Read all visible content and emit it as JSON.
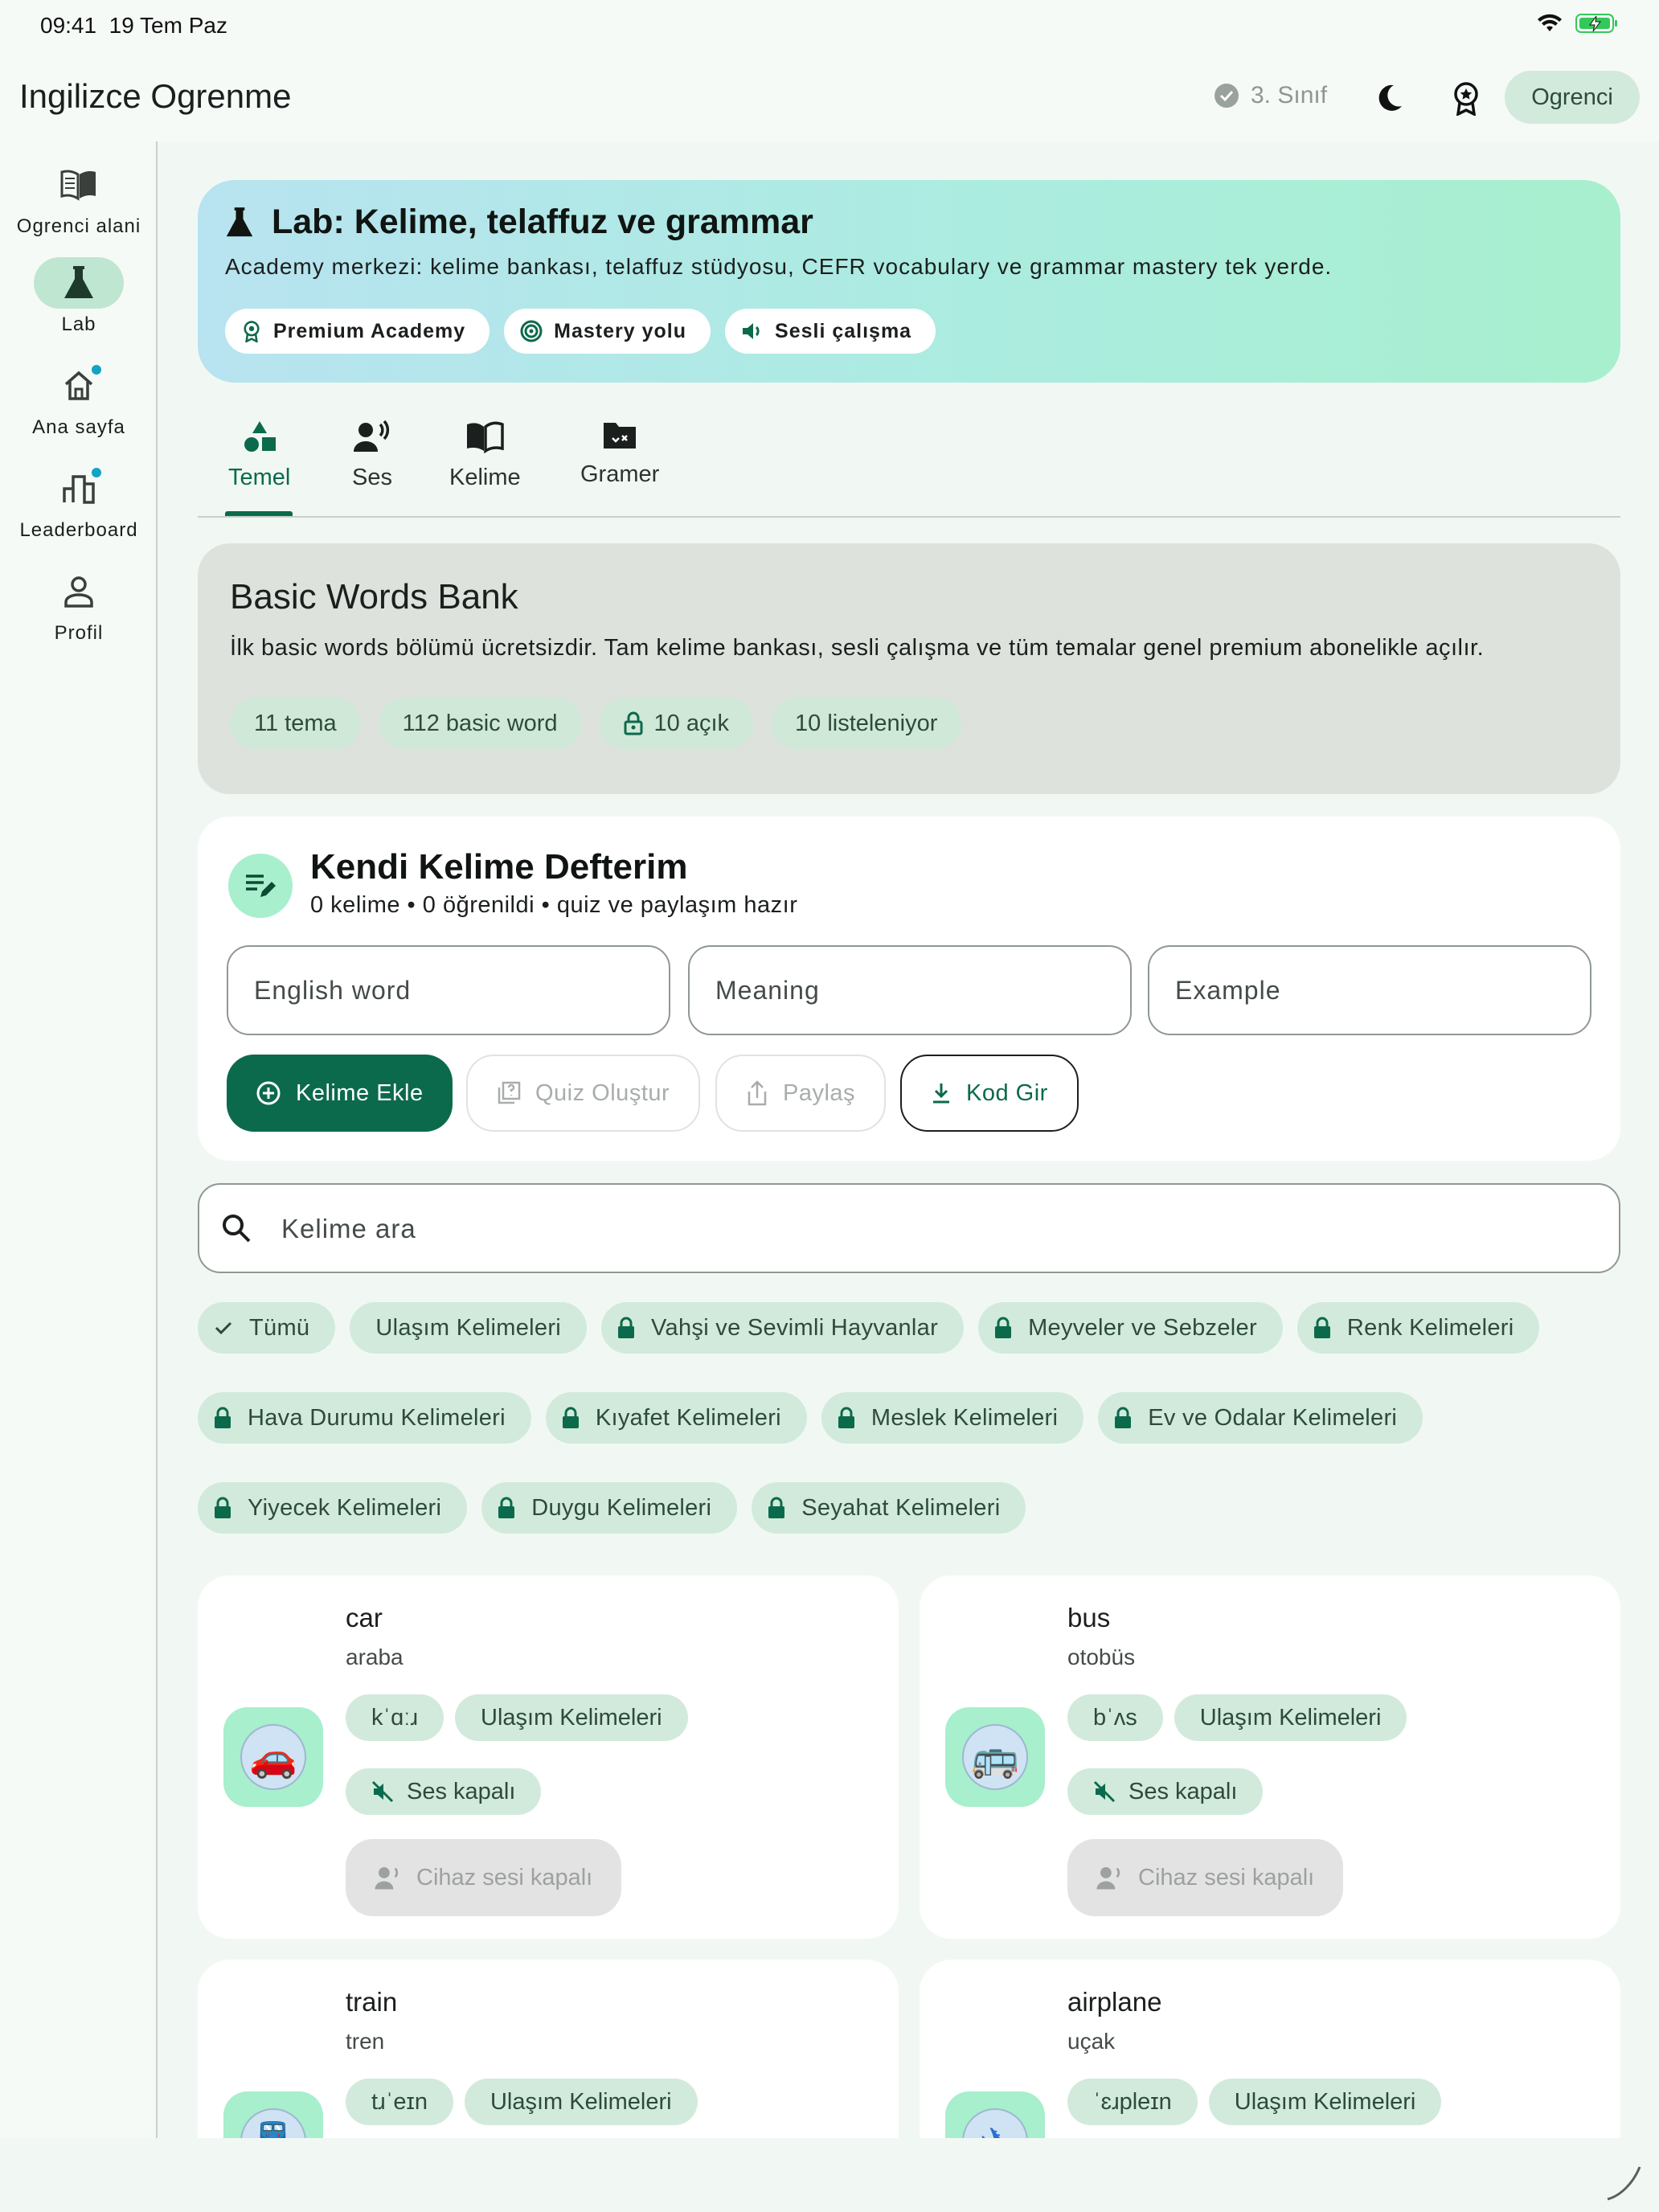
{
  "status": {
    "time": "09:41",
    "date": "19 Tem Paz"
  },
  "app": {
    "title": "Ingilizce Ogrenme",
    "grade": "3. Sınıf",
    "role": "Ogrenci"
  },
  "rail": [
    {
      "label": "Ogrenci alani"
    },
    {
      "label": "Lab"
    },
    {
      "label": "Ana sayfa"
    },
    {
      "label": "Leaderboard"
    },
    {
      "label": "Profil"
    }
  ],
  "hero": {
    "title": "Lab: Kelime, telaffuz ve grammar",
    "subtitle": "Academy merkezi: kelime bankası, telaffuz stüdyosu, CEFR vocabulary ve grammar mastery tek yerde.",
    "pills": [
      "Premium Academy",
      "Mastery yolu",
      "Sesli çalışma"
    ]
  },
  "tabs": [
    "Temel",
    "Ses",
    "Kelime",
    "Gramer"
  ],
  "bank": {
    "title": "Basic Words Bank",
    "subtitle": "İlk basic words bölümü ücretsizdir. Tam kelime bankası, sesli çalışma ve tüm temalar genel premium abonelikle açılır.",
    "chips": [
      "11 tema",
      "112 basic word",
      "10 açık",
      "10 listeleniyor"
    ]
  },
  "notebook": {
    "title": "Kendi Kelime Defterim",
    "subtitle": "0 kelime • 0 öğrenildi • quiz ve paylaşım hazır",
    "placeholders": {
      "word": "English word",
      "meaning": "Meaning",
      "example": "Example"
    },
    "buttons": {
      "add": "Kelime Ekle",
      "quiz": "Quiz Oluştur",
      "share": "Paylaş",
      "code": "Kod Gir"
    }
  },
  "search": {
    "placeholder": "Kelime ara"
  },
  "filters": [
    [
      "Tümü",
      "Ulaşım Kelimeleri",
      "Vahşi ve Sevimli Hayvanlar",
      "Meyveler ve Sebzeler",
      "Renk Kelimeleri"
    ],
    [
      "Hava Durumu Kelimeleri",
      "Kıyafet Kelimeleri",
      "Meslek Kelimeleri",
      "Ev ve Odalar Kelimeleri"
    ],
    [
      "Yiyecek Kelimeleri",
      "Duygu Kelimeleri",
      "Seyahat Kelimeleri"
    ]
  ],
  "words": [
    {
      "word": "car",
      "meaning": "araba",
      "ipa": "kˈɑːɹ",
      "category": "Ulaşım Kelimeleri",
      "sound": "Ses kapalı",
      "device": "Cihaz sesi kapalı",
      "emoji": "🚗"
    },
    {
      "word": "bus",
      "meaning": "otobüs",
      "ipa": "bˈʌs",
      "category": "Ulaşım Kelimeleri",
      "sound": "Ses kapalı",
      "device": "Cihaz sesi kapalı",
      "emoji": "🚌"
    },
    {
      "word": "train",
      "meaning": "tren",
      "ipa": "tɹˈeɪn",
      "category": "Ulaşım Kelimeleri",
      "emoji": "🚆"
    },
    {
      "word": "airplane",
      "meaning": "uçak",
      "ipa": "ˈɛɹpleɪn",
      "category": "Ulaşım Kelimeleri",
      "emoji": "✈"
    }
  ],
  "colors": {
    "primary": "#0c6a4c",
    "chip": "#d2eadb",
    "accent_dot": "#12a4c4"
  }
}
